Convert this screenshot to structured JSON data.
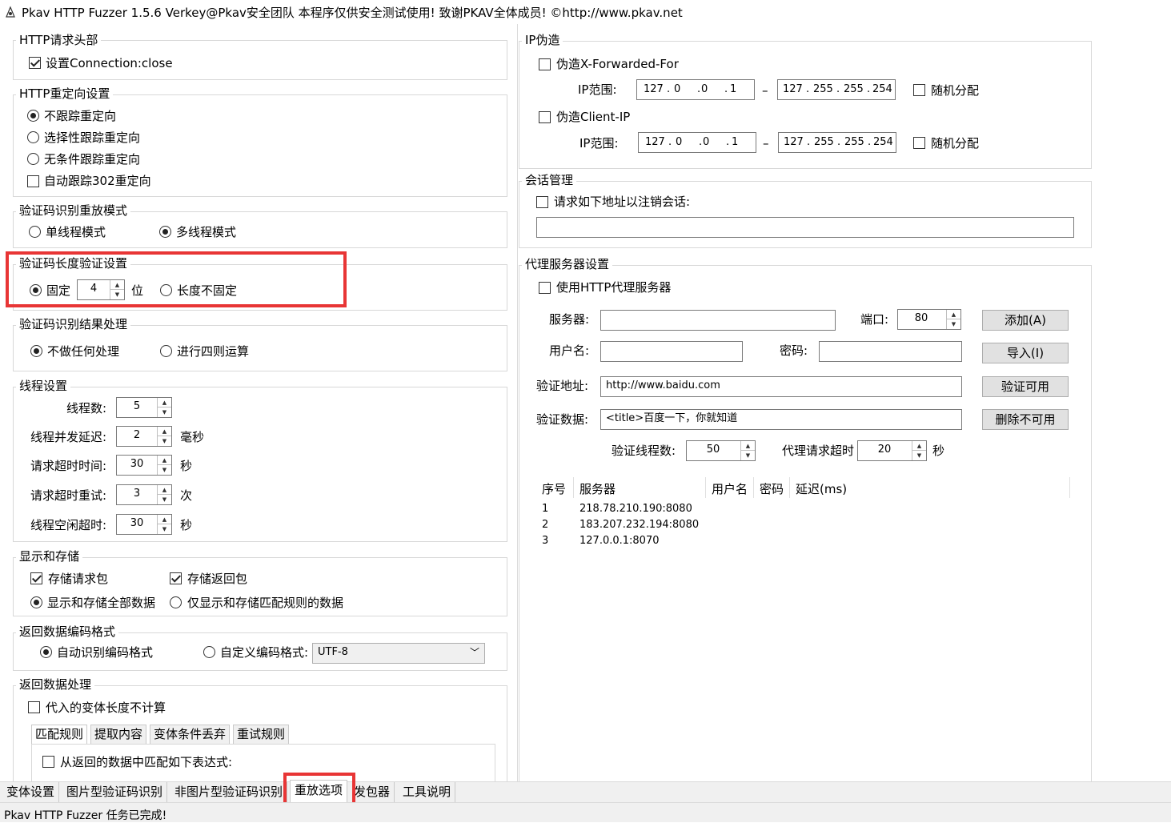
{
  "window": {
    "title": "Pkav HTTP Fuzzer 1.5.6  Verkey@Pkav安全团队  本程序仅供安全测试使用!  致谢PKAV全体成员! ©http://www.pkav.net"
  },
  "left": {
    "http_headers": {
      "title": "HTTP请求头部",
      "set_connection_close": "设置Connection:close"
    },
    "redirect": {
      "title": "HTTP重定向设置",
      "opt_no_follow": "不跟踪重定向",
      "opt_selective": "选择性跟踪重定向",
      "opt_unconditional": "无条件跟踪重定向",
      "auto_302": "自动跟踪302重定向"
    },
    "captcha_mode": {
      "title": "验证码识别重放模式",
      "single": "单线程模式",
      "multi": "多线程模式"
    },
    "captcha_len": {
      "title": "验证码长度验证设置",
      "fixed": "固定",
      "fixed_value": "4",
      "unit": "位",
      "variable": "长度不固定"
    },
    "captcha_result": {
      "title": "验证码识别结果处理",
      "none": "不做任何处理",
      "arith": "进行四则运算"
    },
    "threads": {
      "title": "线程设置",
      "rows": [
        {
          "label": "线程数:",
          "value": "5",
          "unit": ""
        },
        {
          "label": "线程并发延迟:",
          "value": "2",
          "unit": "毫秒"
        },
        {
          "label": "请求超时时间:",
          "value": "30",
          "unit": "秒"
        },
        {
          "label": "请求超时重试:",
          "value": "3",
          "unit": "次"
        },
        {
          "label": "线程空闲超时:",
          "value": "30",
          "unit": "秒"
        }
      ]
    },
    "display": {
      "title": "显示和存储",
      "store_request": "存储请求包",
      "store_response": "存储返回包",
      "show_all": "显示和存储全部数据",
      "show_matched": "仅显示和存储匹配规则的数据"
    },
    "encoding": {
      "title": "返回数据编码格式",
      "auto": "自动识别编码格式",
      "custom": "自定义编码格式:",
      "custom_value": "UTF-8"
    },
    "response": {
      "title": "返回数据处理",
      "exclude_length": "代入的变体长度不计算",
      "tabs": [
        "匹配规则",
        "提取内容",
        "变体条件丢弃",
        "重试规则"
      ],
      "match_expr": "从返回的数据中匹配如下表达式:"
    }
  },
  "right": {
    "ip_spoof": {
      "title": "IP伪造",
      "xff": "伪造X-Forwarded-For",
      "client_ip": "伪造Client-IP",
      "range_label": "IP范围:",
      "random": "随机分配",
      "ip_from": [
        "127",
        "0",
        "0",
        "1"
      ],
      "ip_to": [
        "127",
        "255",
        "255",
        "254"
      ],
      "dash": "–"
    },
    "session": {
      "title": "会话管理",
      "logout": "请求如下地址以注销会话:",
      "url_value": ""
    },
    "proxy": {
      "title": "代理服务器设置",
      "use_proxy": "使用HTTP代理服务器",
      "server_label": "服务器:",
      "port_label": "端口:",
      "port_value": "80",
      "user_label": "用户名:",
      "pass_label": "密码:",
      "verify_url_label": "验证地址:",
      "verify_url_value": "http://www.baidu.com",
      "verify_data_label": "验证数据:",
      "verify_data_value": "<title>百度一下，你就知道",
      "verify_threads_label": "验证线程数:",
      "verify_threads_value": "50",
      "timeout_label": "代理请求超时",
      "timeout_value": "20",
      "timeout_unit": "秒",
      "btn_add": "添加(A)",
      "btn_import": "导入(I)",
      "btn_verify": "验证可用",
      "btn_delete": "删除不可用",
      "table": {
        "headers": [
          "序号",
          "服务器",
          "用户名",
          "密码",
          "延迟(ms)"
        ],
        "rows": [
          {
            "id": "1",
            "server": "218.78.210.190:8080"
          },
          {
            "id": "2",
            "server": "183.207.232.194:8080"
          },
          {
            "id": "3",
            "server": "127.0.0.1:8070"
          }
        ]
      }
    }
  },
  "tabs": [
    "变体设置",
    "图片型验证码识别",
    "非图片型验证码识别",
    "重放选项",
    "发包器",
    "工具说明"
  ],
  "status": "Pkav HTTP Fuzzer 任务已完成!",
  "colors": {
    "highlight": "#e83535",
    "button_bg": "#e1e1e1",
    "panel_bg": "#f0f0f0"
  }
}
